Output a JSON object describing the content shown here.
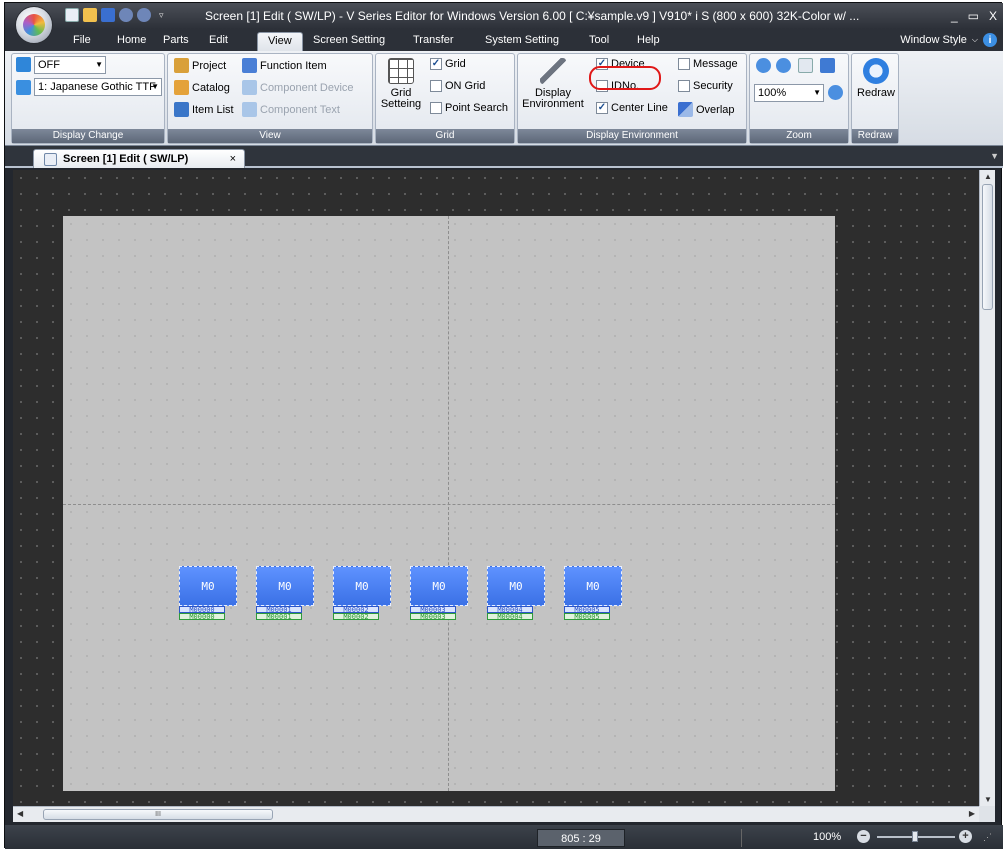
{
  "titlebar": {
    "title": "Screen [1] Edit (        SW/LP) - V Series Editor for Windows Version 6.00 [ C:¥sample.v9 ] V910* i S (800 x 600) 32K-Color w/  ...",
    "qat_screen": "Screen [1] Edit (",
    "buttons": {
      "minimize": "_",
      "restore": "▭",
      "close": "X"
    }
  },
  "menu": {
    "tabs": [
      "File",
      "Home",
      "Parts",
      "Edit",
      "View",
      "Screen Setting",
      "Transfer",
      "System Setting",
      "Tool",
      "Help"
    ],
    "active": "View",
    "window_style": "Window Style"
  },
  "ribbon": {
    "display_change": {
      "label": "Display Change",
      "combo1": "OFF",
      "combo2": "1: Japanese Gothic TTF"
    },
    "view": {
      "label": "View",
      "project": "Project",
      "catalog": "Catalog",
      "item_list": "Item List",
      "function_item": "Function Item",
      "component_device": "Component Device",
      "component_text": "Component Text"
    },
    "grid": {
      "label": "Grid",
      "grid_setting": "Grid\nSetteing",
      "grid_setting_l1": "Grid",
      "grid_setting_l2": "Setteing",
      "grid": "Grid",
      "on_grid": "ON Grid",
      "point_search": "Point Search",
      "grid_checked": true,
      "on_grid_checked": false,
      "point_search_checked": false
    },
    "display_environment": {
      "label": "Display Environment",
      "btn_l1": "Display",
      "btn_l2": "Environment",
      "device": "Device",
      "idno": "IDNo.",
      "center_line": "Center Line",
      "message": "Message",
      "security": "Security",
      "overlap": "Overlap",
      "device_checked": true,
      "idno_checked": false,
      "center_line_checked": true,
      "message_checked": false,
      "security_checked": false
    },
    "zoom": {
      "label": "Zoom",
      "value": "100%"
    },
    "redraw": {
      "label": "Redraw",
      "button": "Redraw"
    }
  },
  "document_tab": {
    "title": "Screen [1] Edit (        SW/LP)",
    "close": "×"
  },
  "canvas": {
    "parts": [
      {
        "label": "M0",
        "addr1": "M00000",
        "addr2": "M00000"
      },
      {
        "label": "M0",
        "addr1": "M00001",
        "addr2": "M00001"
      },
      {
        "label": "M0",
        "addr1": "M00002",
        "addr2": "M00002"
      },
      {
        "label": "M0",
        "addr1": "M00003",
        "addr2": "M00003"
      },
      {
        "label": "M0",
        "addr1": "M00004",
        "addr2": "M00004"
      },
      {
        "label": "M0",
        "addr1": "M00005",
        "addr2": "M00005"
      }
    ]
  },
  "scrollbar": {
    "h_grip": "III"
  },
  "status": {
    "coord": "805 : 29",
    "zoom": "100%"
  },
  "colors": {
    "accent": "#3b71e6",
    "highlight": "#e01818",
    "canvas_bg": "#2d2d2d",
    "screen_bg": "#c3c3c3"
  }
}
